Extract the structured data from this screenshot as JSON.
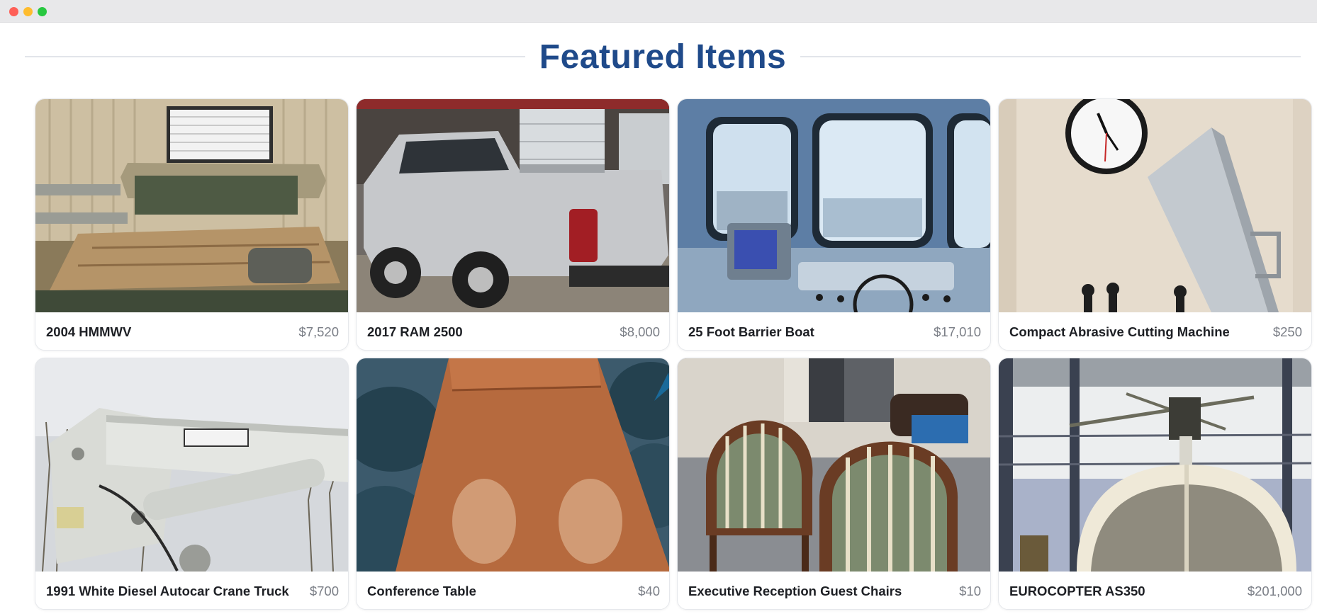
{
  "section": {
    "title": "Featured Items"
  },
  "colors": {
    "title": "#1f4a8a",
    "name": "#1d1f24",
    "price": "#7a7e86"
  },
  "items": [
    {
      "name": "2004 HMMWV",
      "price": "$7,520",
      "image": "hmmwv-photo"
    },
    {
      "name": "2017 RAM 2500",
      "price": "$8,000",
      "image": "pickup-truck-photo"
    },
    {
      "name": "25 Foot Barrier Boat",
      "price": "$17,010",
      "image": "boat-cabin-photo"
    },
    {
      "name": "Compact Abrasive Cutting Machine",
      "price": "$250",
      "image": "cutting-machine-photo"
    },
    {
      "name": "1991 White Diesel Autocar Crane Truck",
      "price": "$700",
      "image": "crane-truck-photo"
    },
    {
      "name": "Conference Table",
      "price": "$40",
      "image": "conference-table-photo"
    },
    {
      "name": "Executive Reception Guest Chairs",
      "price": "$10",
      "image": "guest-chairs-photo"
    },
    {
      "name": "EUROCOPTER AS350",
      "price": "$201,000",
      "image": "helicopter-photo"
    }
  ]
}
